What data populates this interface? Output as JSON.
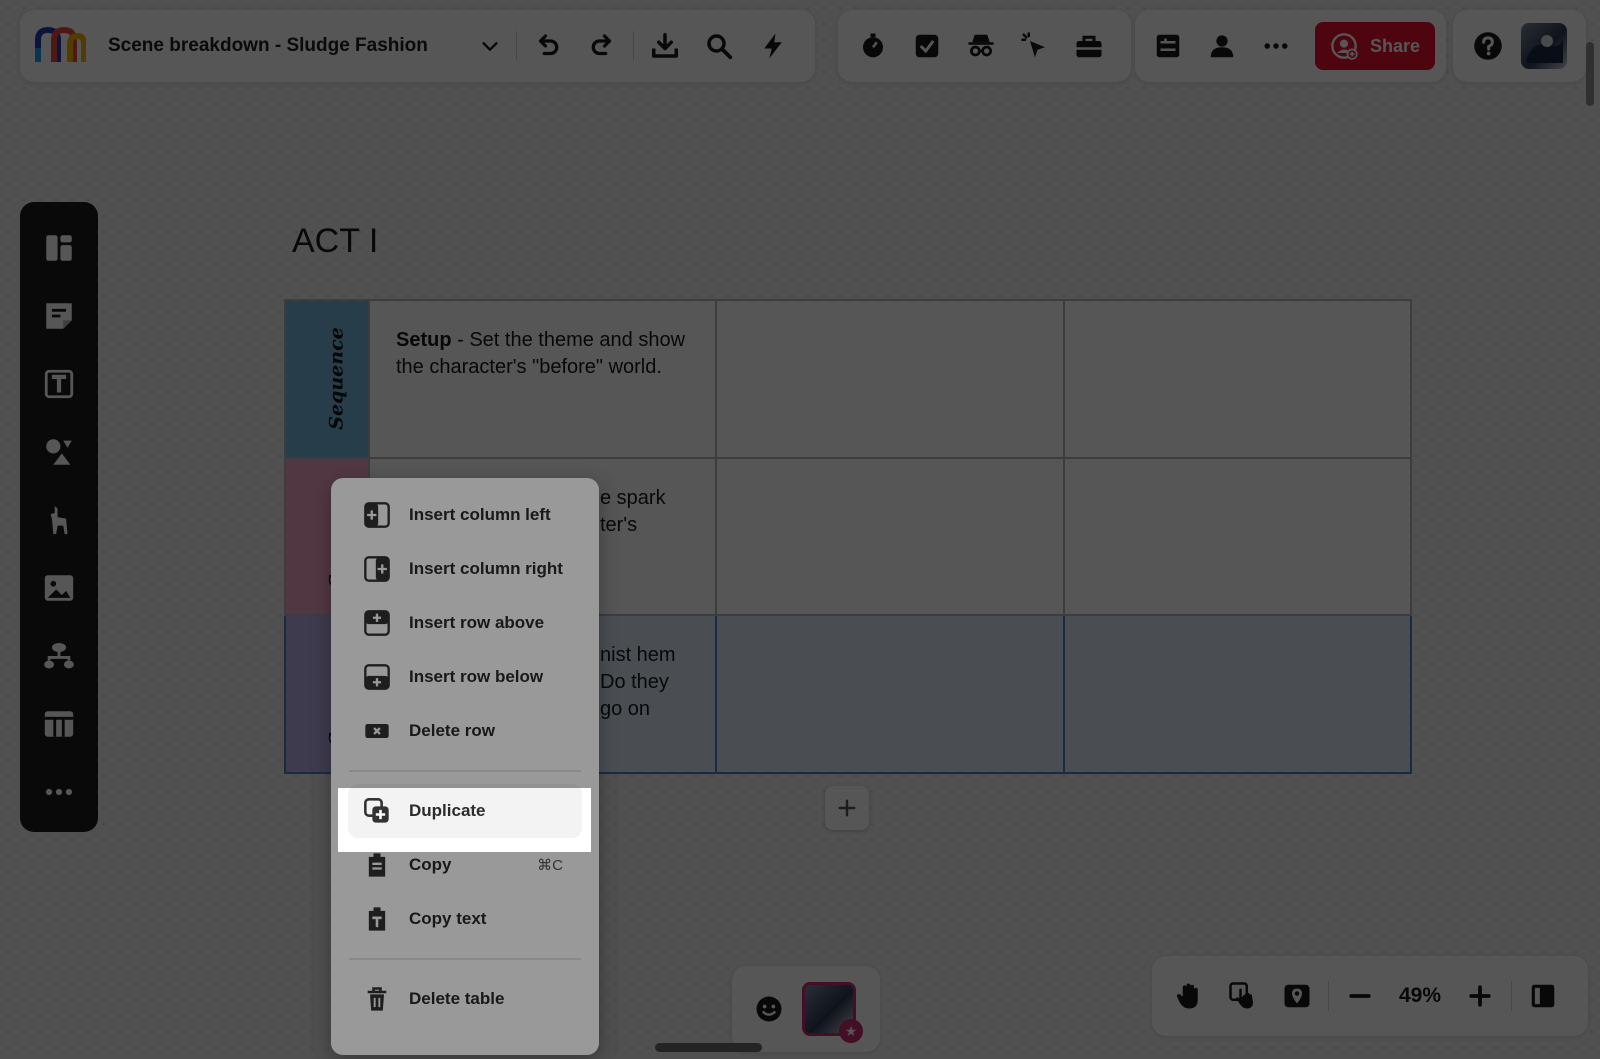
{
  "app": {
    "doc_title": "Scene breakdown - Sludge Fashion",
    "share_label": "Share",
    "zoom": "49%"
  },
  "colors": {
    "share": "#e8112d",
    "selected_row": "#dde9f8",
    "selected_border": "#4b82cc",
    "sequence_blue": "#76b8de",
    "sequence_pink": "#f3a6c7",
    "sequence_purple": "#bcb0e8",
    "sidebar_bg": "#1e1e1e"
  },
  "toolbar": {
    "left_icons": [
      "logo",
      "chevron-down-icon",
      "undo-icon",
      "redo-icon",
      "download-icon",
      "search-icon",
      "lightning-icon"
    ],
    "mid_icons": [
      "timer-icon",
      "checkbox-icon",
      "spy-icon",
      "cursor-icon",
      "toolbox-icon"
    ],
    "right_icons": [
      "board-panel-icon",
      "person-icon",
      "more-icon",
      "share-user-icon",
      "help-icon",
      "avatar"
    ]
  },
  "sidebar": {
    "items": [
      "templates-icon",
      "sticky-note-icon",
      "text-icon",
      "shapes-icon",
      "llama-icon",
      "image-icon",
      "mindmap-icon",
      "table-icon",
      "more-icon"
    ]
  },
  "canvas": {
    "act_title": "ACT I",
    "sequence_label": "Sequence",
    "rows": [
      {
        "label": "Sequence",
        "c1_bold": "Setup",
        "c1_text": " - Set the theme and show the character's \"before\" world.",
        "c2": "",
        "c3": ""
      },
      {
        "label": "Sequence",
        "c1_bold": "",
        "c1_text": "e spark ter's",
        "c2": "",
        "c3": ""
      },
      {
        "label": "Sequence",
        "c1_bold": "",
        "c1_text": "nist hem Do they go on",
        "c2": "",
        "c3": ""
      }
    ]
  },
  "context_menu": {
    "items": [
      {
        "label": "Insert column left",
        "icon": "insert-column-left-icon"
      },
      {
        "label": "Insert column right",
        "icon": "insert-column-right-icon"
      },
      {
        "label": "Insert row above",
        "icon": "insert-row-above-icon"
      },
      {
        "label": "Insert row below",
        "icon": "insert-row-below-icon"
      },
      {
        "label": "Delete row",
        "icon": "delete-row-icon"
      },
      {
        "label": "Duplicate",
        "icon": "duplicate-icon"
      },
      {
        "label": "Copy",
        "icon": "copy-icon",
        "shortcut": "⌘C"
      },
      {
        "label": "Copy text",
        "icon": "copy-text-icon"
      },
      {
        "label": "Delete table",
        "icon": "trash-icon"
      }
    ]
  },
  "bottom": {
    "reaction_icon": "smiley-icon",
    "nav_icons": [
      "hand-icon",
      "touch-icon",
      "map-icon",
      "zoom-out-icon",
      "zoom-in-icon",
      "panel-toggle-icon"
    ]
  }
}
